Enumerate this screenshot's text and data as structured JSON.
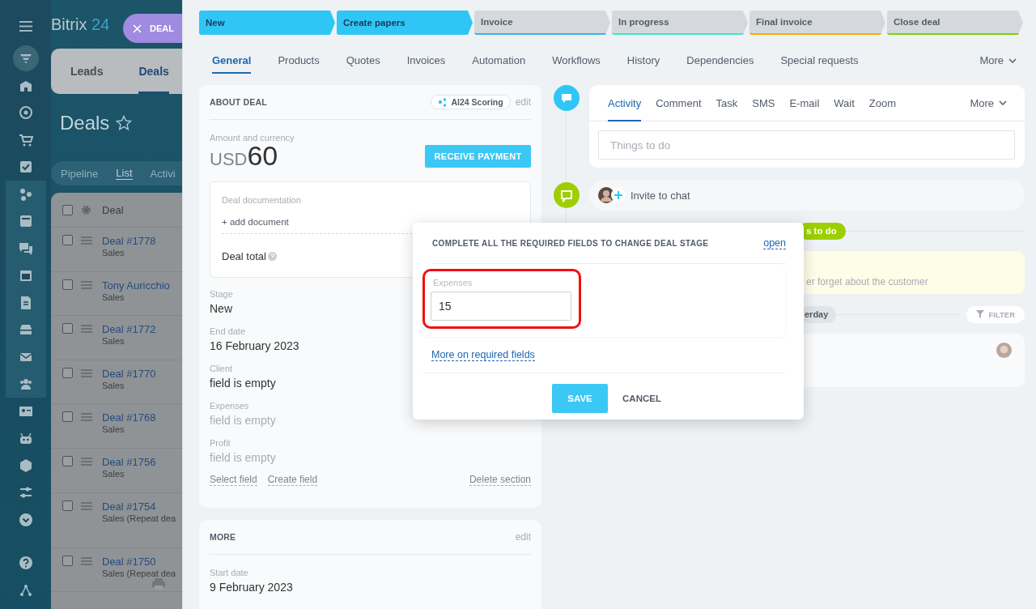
{
  "brand": {
    "name": "Bitrix",
    "number": "24"
  },
  "slider_label": "DEAL",
  "crm_tabs": [
    {
      "label": "Leads",
      "selected": false
    },
    {
      "label": "Deals",
      "selected": true
    }
  ],
  "page_title": "Deals",
  "view_tabs": [
    {
      "label": "Pipeline",
      "selected": false
    },
    {
      "label": "List",
      "selected": true
    },
    {
      "label": "Activi",
      "selected": false
    }
  ],
  "list": {
    "column": "Deal",
    "all_checked": false,
    "rows": [
      {
        "title": "Deal #1778",
        "pipeline": "Sales",
        "checked": false
      },
      {
        "title": "Tony Auricchio",
        "pipeline": "Sales",
        "checked": false
      },
      {
        "title": "Deal #1772",
        "pipeline": "Sales",
        "checked": false
      },
      {
        "title": "Deal #1770",
        "pipeline": "Sales",
        "checked": false
      },
      {
        "title": "Deal #1768",
        "pipeline": "Sales",
        "checked": false
      },
      {
        "title": "Deal #1756",
        "pipeline": "Sales",
        "checked": false
      },
      {
        "title": "Deal #1754",
        "pipeline": "Sales (Repeat dea",
        "checked": false
      },
      {
        "title": "Deal #1750",
        "pipeline": "Sales (Repeat dea",
        "checked": false
      }
    ]
  },
  "stages": [
    {
      "label": "New",
      "passed": true,
      "color": "#2fc6f6"
    },
    {
      "label": "Create papers",
      "passed": true,
      "color": "#2fc6f6"
    },
    {
      "label": "Invoice",
      "passed": false,
      "color": "#39b3ea"
    },
    {
      "label": "In progress",
      "passed": false,
      "color": "#47e4c2"
    },
    {
      "label": "Final invoice",
      "passed": false,
      "color": "#ffa900"
    },
    {
      "label": "Close deal",
      "passed": false,
      "color": "#7bd500"
    }
  ],
  "tabs": [
    {
      "label": "General",
      "selected": true
    },
    {
      "label": "Products",
      "selected": false
    },
    {
      "label": "Quotes",
      "selected": false
    },
    {
      "label": "Invoices",
      "selected": false
    },
    {
      "label": "Automation",
      "selected": false
    },
    {
      "label": "Workflows",
      "selected": false
    },
    {
      "label": "History",
      "selected": false
    },
    {
      "label": "Dependencies",
      "selected": false
    },
    {
      "label": "Special requests",
      "selected": false
    }
  ],
  "tabs_more": "More",
  "about": {
    "title": "ABOUT DEAL",
    "scoring": "AI24 Scoring",
    "edit": "edit",
    "amount_label": "Amount and currency",
    "currency": "USD",
    "amount": "60",
    "payment_button": "RECEIVE PAYMENT",
    "documentation": {
      "title": "Deal documentation",
      "add": "+ add document",
      "total": "Deal total"
    },
    "fields": [
      {
        "label": "Stage",
        "value": "New",
        "empty": false
      },
      {
        "label": "End date",
        "value": "16 February 2023",
        "empty": false
      },
      {
        "label": "Client",
        "value": "field is empty",
        "empty": false
      },
      {
        "label": "Expenses",
        "value": "field is empty",
        "empty": true
      },
      {
        "label": "Profit",
        "value": "field is empty",
        "empty": true
      }
    ],
    "links": [
      "Select field",
      "Create field"
    ],
    "delete": "Delete section"
  },
  "more_section": {
    "title": "MORE",
    "edit": "edit",
    "fields": [
      {
        "label": "Start date",
        "value": "9 February 2023",
        "empty": false
      }
    ]
  },
  "activity": {
    "tabs": [
      {
        "label": "Activity",
        "selected": true
      },
      {
        "label": "Comment",
        "selected": false
      },
      {
        "label": "Task",
        "selected": false
      },
      {
        "label": "SMS",
        "selected": false
      },
      {
        "label": "E-mail",
        "selected": false
      },
      {
        "label": "Wait",
        "selected": false
      },
      {
        "label": "Zoom",
        "selected": false
      }
    ],
    "more": "More",
    "placeholder": "Things to do"
  },
  "chat": {
    "label": "Invite to chat"
  },
  "timeline": {
    "todo_badge": "s to do",
    "reminder": "er forget about the customer",
    "day_badge": "erday",
    "filter": "FILTER"
  },
  "modal": {
    "title": "COMPLETE ALL THE REQUIRED FIELDS TO CHANGE DEAL STAGE",
    "open": "open",
    "field": {
      "label": "Expenses",
      "value": "15",
      "highlighted": true
    },
    "help_link": "More on required fields",
    "save": "SAVE",
    "cancel": "CANCEL"
  }
}
